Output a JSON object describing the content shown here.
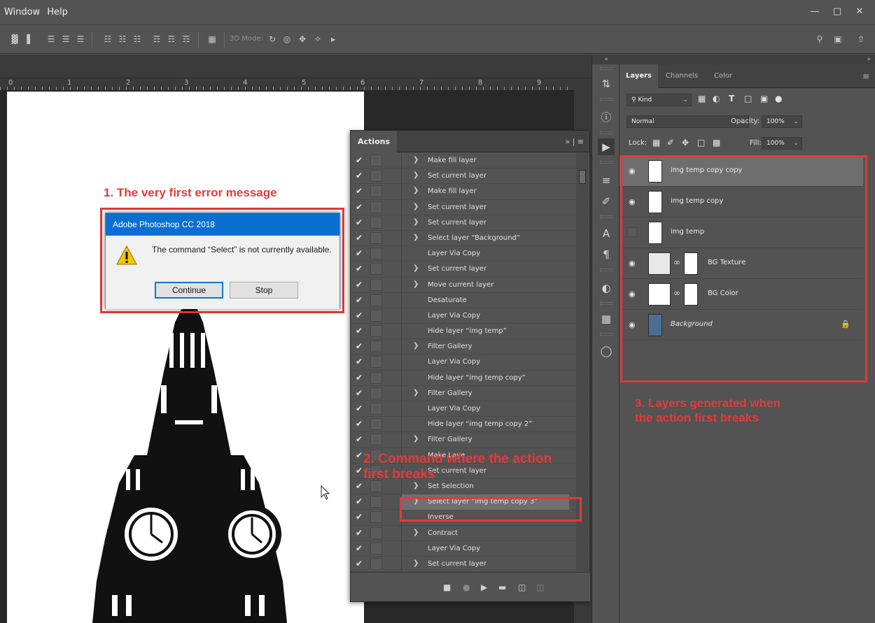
{
  "menubar": {
    "items": [
      "Window",
      "Help"
    ]
  },
  "optionsbar": {
    "mode_label": "3D Mode:"
  },
  "ruler": {
    "ticks": [
      "0",
      "1",
      "2",
      "3",
      "4",
      "5",
      "6",
      "7",
      "8",
      "9"
    ]
  },
  "dialog": {
    "title": "Adobe Photoshop CC 2018",
    "message": "The command “Select” is not currently available.",
    "continue_label": "Continue",
    "stop_label": "Stop"
  },
  "annotations": {
    "first": "1. The very first error message",
    "second_line1": "2. Command where the action",
    "second_line2": "first breaks",
    "third_line1": "3. Layers generated when",
    "third_line2": "the action first breaks"
  },
  "actions": {
    "tab_label": "Actions",
    "items": [
      {
        "label": "Make fill layer",
        "chevron": true
      },
      {
        "label": "Set current layer",
        "chevron": true
      },
      {
        "label": "Make fill layer",
        "chevron": true
      },
      {
        "label": "Set current layer",
        "chevron": true
      },
      {
        "label": "Set current layer",
        "chevron": true
      },
      {
        "label": "Select layer “Background”",
        "chevron": true
      },
      {
        "label": "Layer Via Copy",
        "chevron": false
      },
      {
        "label": "Set current layer",
        "chevron": true
      },
      {
        "label": "Move current layer",
        "chevron": true
      },
      {
        "label": "Desaturate",
        "chevron": false
      },
      {
        "label": "Layer Via Copy",
        "chevron": false
      },
      {
        "label": "Hide layer “img temp”",
        "chevron": false
      },
      {
        "label": "Filter Gallery",
        "chevron": true
      },
      {
        "label": "Layer Via Copy",
        "chevron": false
      },
      {
        "label": "Hide layer “img temp copy”",
        "chevron": false
      },
      {
        "label": "Filter Gallery",
        "chevron": true
      },
      {
        "label": "Layer Via Copy",
        "chevron": false
      },
      {
        "label": "Hide layer “img temp copy 2”",
        "chevron": false
      },
      {
        "label": "Filter Gallery",
        "chevron": true
      },
      {
        "label": "Make Laye",
        "chevron": false
      },
      {
        "label": "Set current layer",
        "chevron": false
      },
      {
        "label": "Set Selection",
        "chevron": true
      },
      {
        "label": "Select layer “img temp copy 3”",
        "chevron": true,
        "highlight": true
      },
      {
        "label": "Inverse",
        "chevron": false
      },
      {
        "label": "Contract",
        "chevron": true
      },
      {
        "label": "Layer Via Copy",
        "chevron": false
      },
      {
        "label": "Set current layer",
        "chevron": true
      }
    ]
  },
  "layers": {
    "tabs": [
      "Layers",
      "Channels",
      "Color"
    ],
    "filter_label": "Kind",
    "blend_mode": "Normal",
    "opacity_label": "Opacity:",
    "opacity_value": "100%",
    "lock_label": "Lock:",
    "fill_label": "Fill:",
    "fill_value": "100%",
    "items": [
      {
        "name": "img temp copy  copy",
        "visible": true,
        "selected": true,
        "italic": false
      },
      {
        "name": "img temp copy",
        "visible": true,
        "selected": false,
        "italic": false
      },
      {
        "name": "img temp",
        "visible": false,
        "selected": false,
        "italic": false
      },
      {
        "name": "BG Texture",
        "visible": true,
        "selected": false,
        "italic": false
      },
      {
        "name": "BG Color",
        "visible": true,
        "selected": false,
        "italic": false
      },
      {
        "name": "Background",
        "visible": true,
        "selected": false,
        "italic": true
      }
    ]
  },
  "colors": {
    "annotation": "#e23b3b",
    "dialog_title_bg": "#0b6ed1",
    "panel_bg": "#535353"
  }
}
